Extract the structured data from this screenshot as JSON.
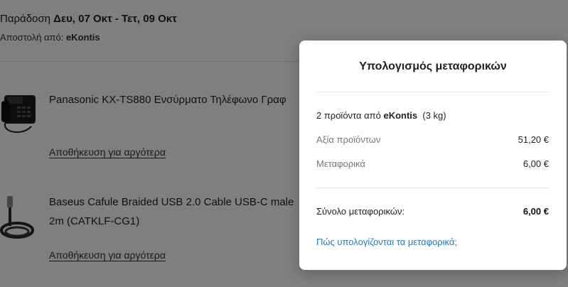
{
  "background": {
    "delivery_prefix": "Παράδοση ",
    "delivery_dates": "Δευ, 07 Οκτ - Τετ, 09 Οκτ",
    "shipfrom_prefix": "Αποστολή από: ",
    "shipfrom_store": "eKontis",
    "products": [
      {
        "title": "Panasonic KX-TS880 Ενσύρματο Τηλέφωνο Γραφ",
        "save_label": "Αποθήκευση για αργότερα"
      },
      {
        "title_line1": "Baseus Cafule Braided USB 2.0 Cable USB-C male",
        "title_line2": "2m (CATKLF-CG1)",
        "save_label": "Αποθήκευση για αργότερα"
      }
    ]
  },
  "modal": {
    "title": "Υπολογισμός μεταφορικών",
    "summary_prefix": "2 προϊόντα από ",
    "summary_store": "eKontis",
    "summary_weight": "(3 kg)",
    "products_value_label": "Αξία προϊόντων",
    "products_value": "51,20 €",
    "shipping_label": "Μεταφορικά",
    "shipping_value": "6,00 €",
    "total_label": "Σύνολο μεταφορικών:",
    "total_value": "6,00 €",
    "help_link": "Πώς υπολογίζονται τα μεταφορικά;"
  }
}
